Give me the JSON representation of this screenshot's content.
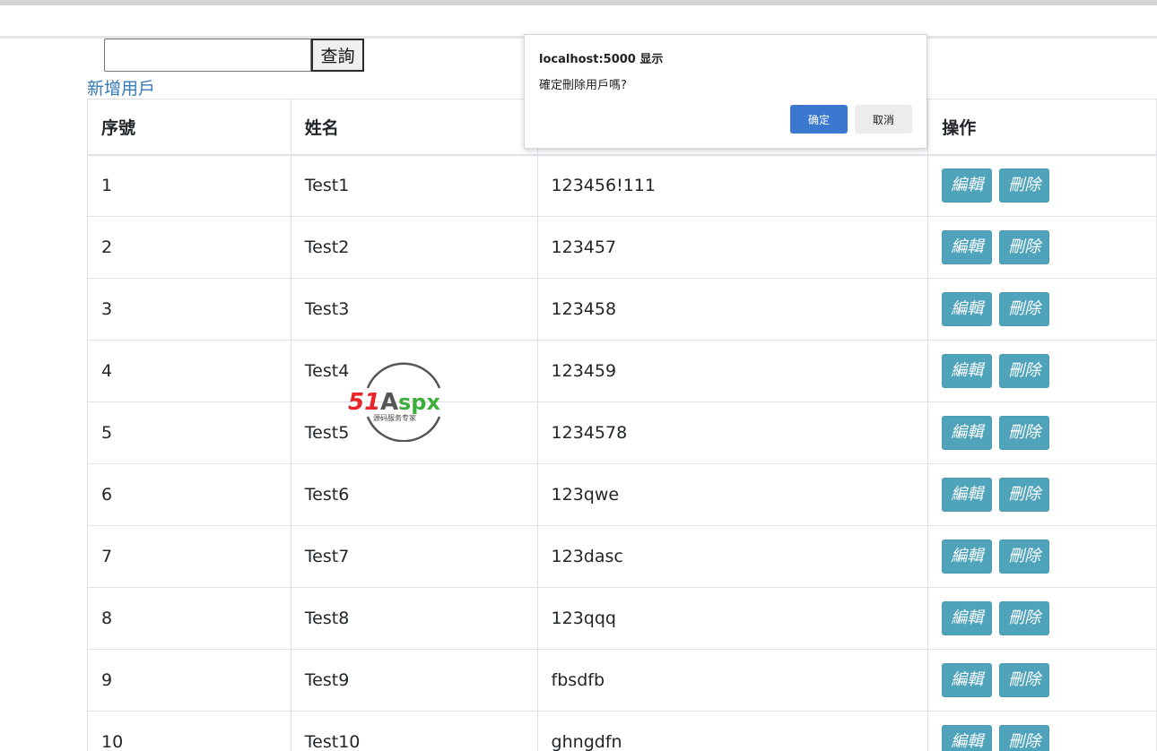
{
  "search": {
    "value": "",
    "placeholder": "",
    "button_label": "查詢"
  },
  "add_user_link": "新增用戶",
  "table": {
    "headers": [
      "序號",
      "姓名",
      "",
      "操作"
    ],
    "rows": [
      {
        "id": "1",
        "name": "Test1",
        "password": "123456!111"
      },
      {
        "id": "2",
        "name": "Test2",
        "password": "123457"
      },
      {
        "id": "3",
        "name": "Test3",
        "password": "123458"
      },
      {
        "id": "4",
        "name": "Test4",
        "password": "123459"
      },
      {
        "id": "5",
        "name": "Test5",
        "password": "1234578"
      },
      {
        "id": "6",
        "name": "Test6",
        "password": "123qwe"
      },
      {
        "id": "7",
        "name": "Test7",
        "password": "123dasc"
      },
      {
        "id": "8",
        "name": "Test8",
        "password": "123qqq"
      },
      {
        "id": "9",
        "name": "Test9",
        "password": "fbsdfb"
      },
      {
        "id": "10",
        "name": "Test10",
        "password": "ghngdfn"
      }
    ],
    "edit_label": "編輯",
    "delete_label": "刪除"
  },
  "dialog": {
    "title": "localhost:5000 显示",
    "message": "確定刪除用戶嗎?",
    "ok_label": "确定",
    "cancel_label": "取消"
  },
  "watermark": {
    "logo_text_red": "51",
    "logo_text_dark": "A",
    "logo_text_green": "spx",
    "tagline": "源码服务专家"
  },
  "colors": {
    "link": "#337ab7",
    "action_button": "#4fa3bb",
    "dialog_ok": "#3b78d0",
    "watermark_red": "#e8262a",
    "watermark_green": "#3cae3c"
  }
}
